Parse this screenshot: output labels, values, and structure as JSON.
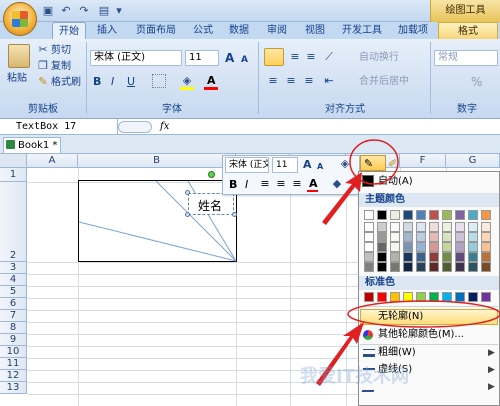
{
  "title_bar": {
    "drawing_tools": "绘图工具"
  },
  "tabs": [
    "开始",
    "插入",
    "页面布局",
    "公式",
    "数据",
    "审阅",
    "视图",
    "开发工具",
    "加载项",
    "格式"
  ],
  "clipboard": {
    "paste": "粘贴",
    "cut": "剪切",
    "copy": "复制",
    "format_painter": "格式刷",
    "group": "剪贴板"
  },
  "font": {
    "name": "宋体 (正文)",
    "size": "11",
    "bold": "B",
    "italic": "I",
    "underline": "U",
    "color_a": "A",
    "grow": "A",
    "shrink": "A",
    "group": "字体"
  },
  "alignment": {
    "wrap": "自动换行",
    "merge": "合并后居中",
    "group": "对齐方式"
  },
  "number": {
    "format": "常规",
    "group": "数字",
    "percent": "%"
  },
  "formula_bar": {
    "name_box": "TextBox 17",
    "fx": "fx"
  },
  "workbook": {
    "tab": "Book1 *"
  },
  "columns": [
    "A",
    "B",
    "C",
    "D",
    "E",
    "F",
    "G"
  ],
  "rows": [
    "1",
    "2",
    "3",
    "4",
    "5",
    "6",
    "7",
    "8",
    "9",
    "10",
    "11",
    "12",
    "13"
  ],
  "cell_text": "姓名",
  "mini_toolbar": {
    "font": "宋体 (正文",
    "size": "11",
    "bold": "B",
    "italic": "I"
  },
  "menu": {
    "auto": "自动(A)",
    "theme_colors": "主题颜色",
    "standard_colors": "标准色",
    "no_outline": "无轮廓(N)",
    "more_colors": "其他轮廓颜色(M)...",
    "weight": "粗细(W)",
    "dashes": "虚线(S)"
  },
  "colors": {
    "theme_top": [
      "#ffffff",
      "#000000",
      "#eeece1",
      "#1f497d",
      "#4f81bd",
      "#c0504d",
      "#9bbb59",
      "#8064a2",
      "#4bacc6",
      "#f79646"
    ],
    "standard": [
      "#c00000",
      "#ff0000",
      "#ffc000",
      "#ffff00",
      "#92d050",
      "#00b050",
      "#00b0f0",
      "#0070c0",
      "#002060",
      "#7030a0"
    ],
    "highlight": "#ffe08a",
    "annotation": "#e02020"
  },
  "watermark": "我爱IT技术网"
}
